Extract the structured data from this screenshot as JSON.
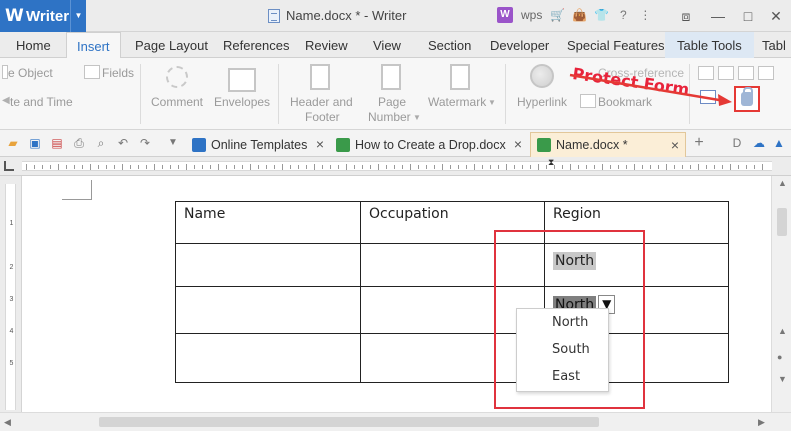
{
  "window": {
    "app_name": "Writer",
    "title": "Name.docx * - Writer",
    "wps_label": "wps",
    "brand_color": "#2e73c5"
  },
  "menu": {
    "tabs": [
      "Home",
      "Insert",
      "Page Layout",
      "References",
      "Review",
      "View",
      "Section",
      "Developer",
      "Special Features",
      "Table Tools",
      "Tabl"
    ],
    "active": "Insert"
  },
  "ribbon": {
    "object_label": "e Object",
    "fields_label": "Fields",
    "date_time_label": "te and Time",
    "comment_label": "Comment",
    "envelopes_label": "Envelopes",
    "header_footer_label_1": "Header and",
    "header_footer_label_2": "Footer",
    "page_number_label_1": "Page",
    "page_number_label_2": "Number",
    "watermark_label": "Watermark",
    "hyperlink_label": "Hyperlink",
    "bookmark_label": "Bookmark",
    "cross_reference_label": "Cross-reference",
    "protect_form_callout": "Protect Form",
    "highlight_color": "#e53935"
  },
  "doc_tabs": [
    {
      "label": "Online Templates",
      "close": "×"
    },
    {
      "label": "How to Create a Drop.docx",
      "close": "×"
    },
    {
      "label": "Name.docx *",
      "close": "×"
    }
  ],
  "ruler": {
    "vertical_numbers": [
      "1",
      "2",
      "3",
      "4",
      "5"
    ]
  },
  "document": {
    "table_headers": [
      "Name",
      "Occupation",
      "Region"
    ],
    "field_text_value": "North",
    "dropdown_value": "North",
    "dropdown_arrow": "▼",
    "dropdown_options": [
      "North",
      "South",
      "East"
    ]
  }
}
